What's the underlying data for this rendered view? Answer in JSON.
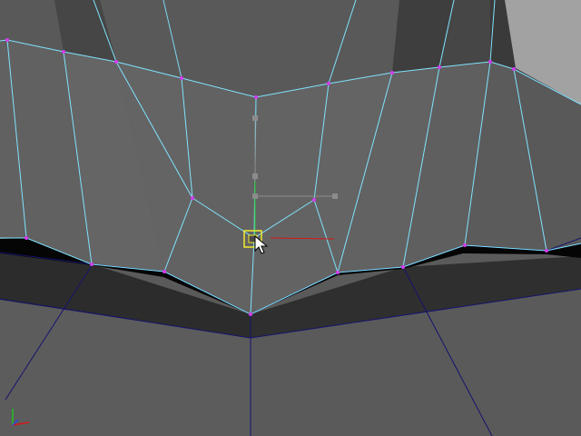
{
  "app": {
    "view": "3D viewport",
    "mode": "vertex-edit"
  },
  "colors": {
    "background": "#5a5a5a",
    "face_light": "#6a6a6a",
    "face_mid": "#5e5e5e",
    "face_dark": "#3f3f3f",
    "face_darker": "#2d2d2d",
    "shadow": "#050505",
    "selected_edge": "#7fe3ff",
    "unselected_edge": "#15136e",
    "vertex": "#d43cf0",
    "manip_y": "#1fc21f",
    "manip_x": "#d81818",
    "manip_handle": "#8c8c8c",
    "selection_box": "#f2ea2c",
    "axis_x": "#d81818",
    "axis_y": "#1fc21f",
    "axis_z": "#2b42e0"
  },
  "gizmo": {
    "axes": [
      "x",
      "y",
      "z"
    ],
    "icon": "axis-triad-icon"
  },
  "manipulator": {
    "icon": "move-manipulator-icon",
    "selected": true
  }
}
